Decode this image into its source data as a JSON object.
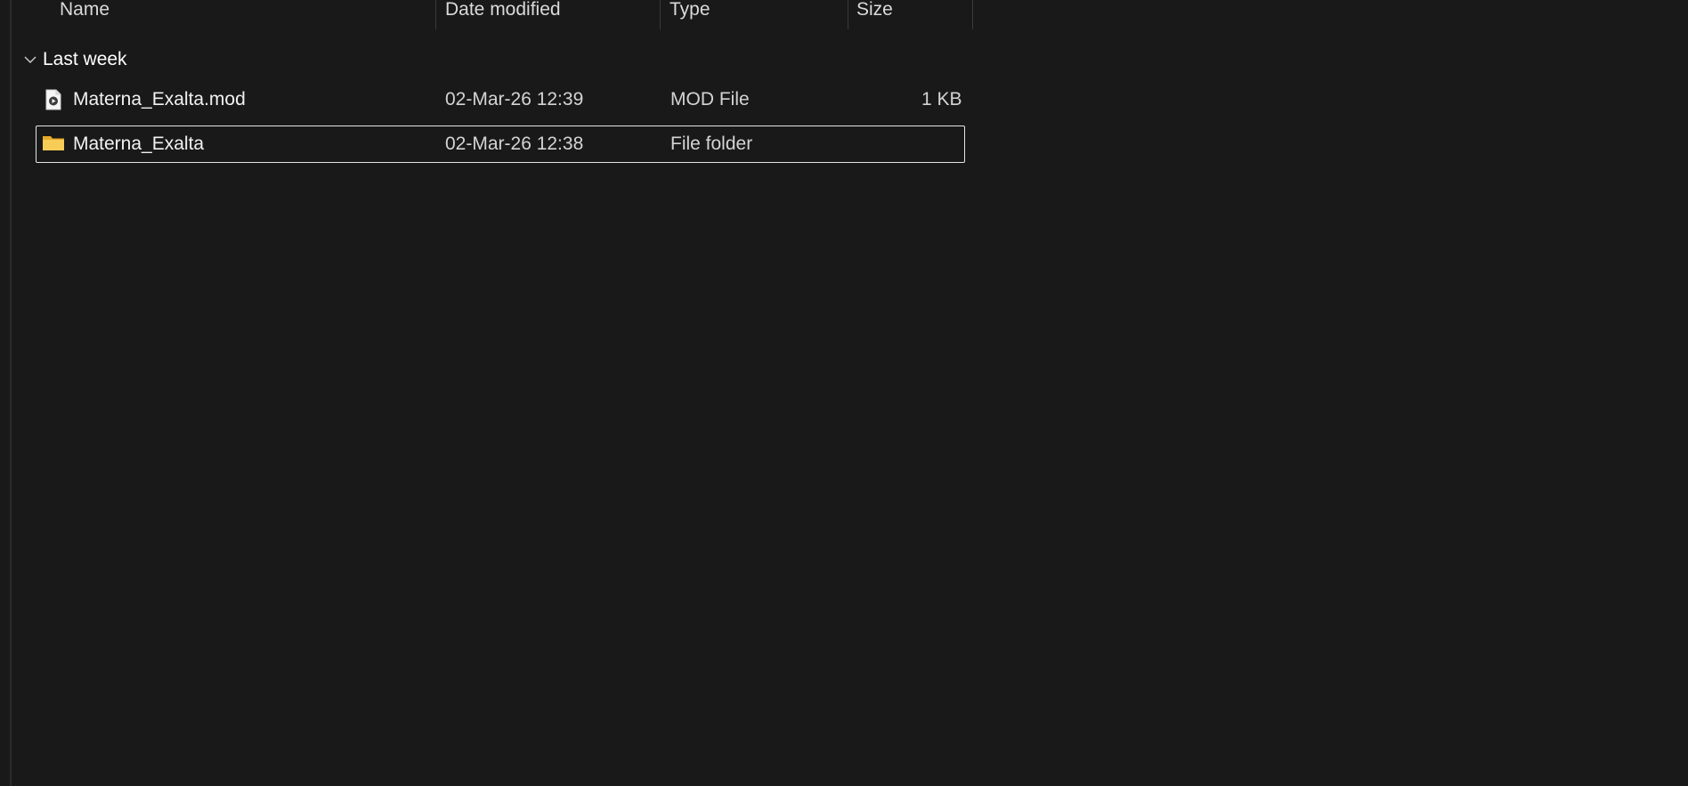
{
  "columns": {
    "name": "Name",
    "date_modified": "Date modified",
    "type": "Type",
    "size": "Size"
  },
  "group": {
    "label": "Last week",
    "expanded": true
  },
  "files": [
    {
      "name": "Materna_Exalta.mod",
      "date": "02-Mar-26 12:39",
      "type": "MOD File",
      "size": "1 KB",
      "icon": "media-file-icon",
      "selected": false
    },
    {
      "name": "Materna_Exalta",
      "date": "02-Mar-26 12:38",
      "type": "File folder",
      "size": "",
      "icon": "folder-icon",
      "selected": true
    }
  ],
  "colors": {
    "background": "#191919",
    "folder": "#f4c542",
    "selection_outline": "#e6e6e6"
  }
}
